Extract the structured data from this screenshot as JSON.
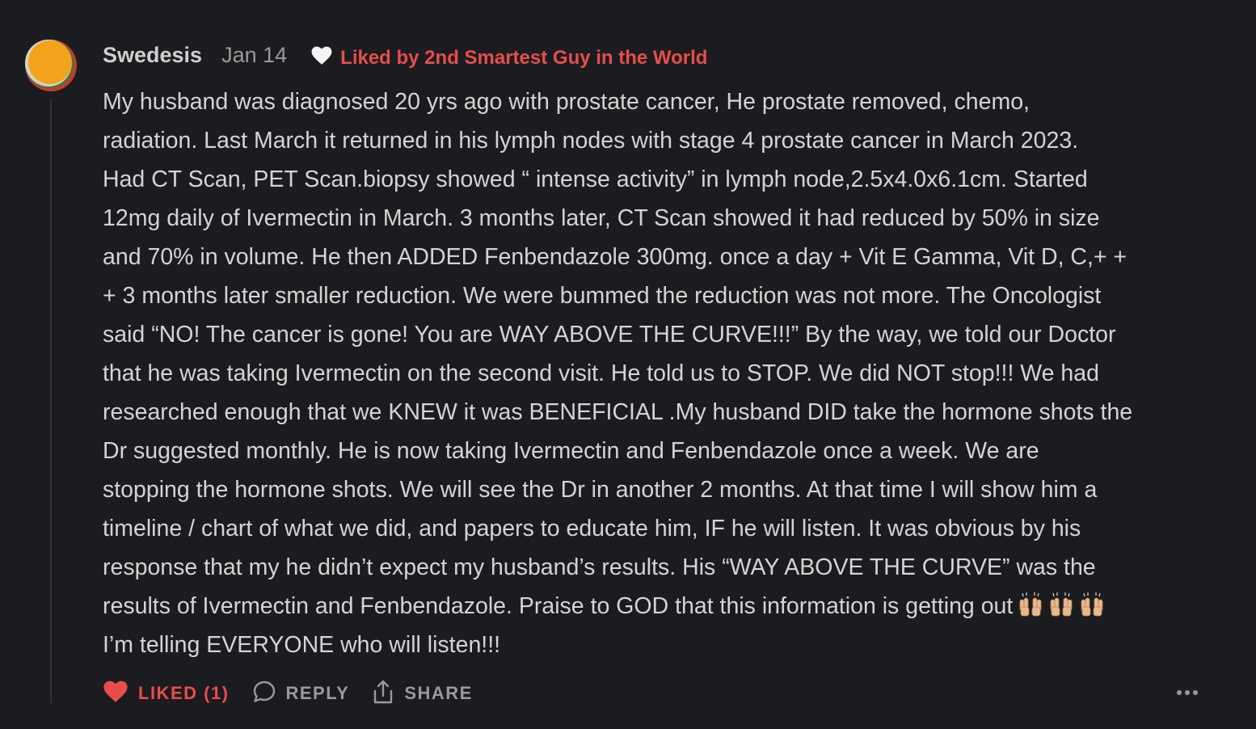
{
  "comment": {
    "author": "Swedesis",
    "date": "Jan 14",
    "liked_by": "Liked by 2nd Smartest Guy in the World",
    "body_lines": [
      "My husband was diagnosed 20 yrs ago with prostate cancer, He prostate removed, chemo,",
      "radiation. Last March it returned in his lymph nodes with stage 4 prostate cancer in March 2023.",
      "Had CT Scan, PET Scan.biopsy showed “ intense activity” in lymph node,2.5x4.0x6.1cm. Started",
      "12mg daily of Ivermectin in March. 3 months later, CT Scan showed it had reduced by 50% in size",
      "and 70% in volume. He then ADDED Fenbendazole 300mg. once a day + Vit E Gamma, Vit D, C,+ +",
      "+ 3 months later smaller reduction. We were bummed the reduction was not more. The Oncologist",
      "said “NO! The cancer is gone! You are WAY ABOVE THE CURVE!!!” By the way, we told our Doctor",
      "that he was taking Ivermectin on the second visit. He told us to STOP. We did NOT stop!!! We had",
      "researched enough that we KNEW it was BENEFICIAL .My husband DID take the hormone shots the",
      "Dr suggested monthly. He is now taking Ivermectin and Fenbendazole once a week. We are",
      "stopping the hormone shots. We will see the Dr in another 2 months. At that time I will show him a",
      "timeline / chart of what we did, and papers to educate him, IF he will listen. It was obvious by his",
      "response that my he didn’t expect my husband’s results. His “WAY ABOVE THE CURVE” was the",
      "results of Ivermectin and Fenbendazole. Praise to GOD that this information is getting out",
      "I’m telling EVERYONE who will listen!!!"
    ],
    "emoji_icons": [
      "raising-hands-icon",
      "raising-hands-icon",
      "raising-hands-icon"
    ]
  },
  "actions": {
    "liked_label": "LIKED (1)",
    "reply_label": "REPLY",
    "share_label": "SHARE"
  },
  "colors": {
    "background": "#1b1c1f",
    "text": "#d4d4d4",
    "muted": "#9a9a9a",
    "accent_red": "#ea4c4c"
  }
}
